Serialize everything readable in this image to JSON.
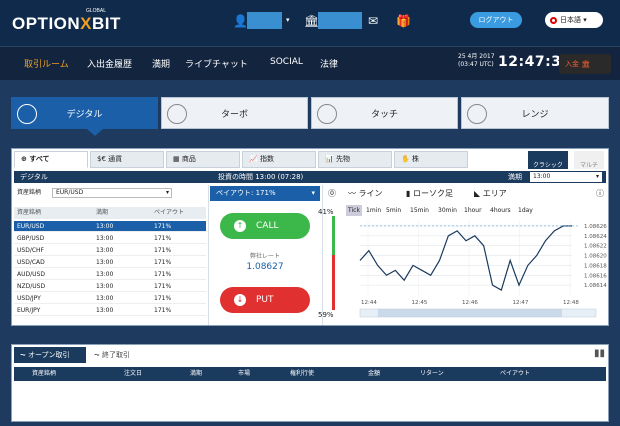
{
  "header": {
    "logo_main": "OPTION",
    "logo_x": "X",
    "logo_end": "BIT",
    "logo_sub": "GLOBAL",
    "logout_label": "ログアウト",
    "language": "日本語"
  },
  "nav": {
    "items": [
      "取引ルーム",
      "入出金履歴",
      "満期",
      "ライブチャット",
      "SOCIAL",
      "法律"
    ],
    "date": "25 4月 2017",
    "date_sub": "(03:47 UTC)",
    "clock": "12:47:32",
    "deposit_label": "入金"
  },
  "mode_tabs": [
    "デジタル",
    "ターボ",
    "タッチ",
    "レンジ"
  ],
  "category_tabs": [
    "すべて",
    "通貨",
    "商品",
    "指数",
    "先物",
    "株"
  ],
  "view_modes": [
    "クラシック",
    "マルチ"
  ],
  "bar": {
    "title": "デジタル",
    "invest_time_label": "投資の時間 13:00 (07:28)",
    "expiry_label": "満期",
    "expiry_value": "13:00"
  },
  "asset_filter": {
    "label": "資産銘柄",
    "value": "EUR/USD"
  },
  "table": {
    "headers": [
      "資産銘柄",
      "満期",
      "ペイアウト"
    ],
    "rows": [
      [
        "EUR/USD",
        "13:00",
        "171%"
      ],
      [
        "GBP/USD",
        "13:00",
        "171%"
      ],
      [
        "USD/CHF",
        "13:00",
        "171%"
      ],
      [
        "USD/CAD",
        "13:00",
        "171%"
      ],
      [
        "AUD/USD",
        "13:00",
        "171%"
      ],
      [
        "NZD/USD",
        "13:00",
        "171%"
      ],
      [
        "USD/JPY",
        "13:00",
        "171%"
      ],
      [
        "EUR/JPY",
        "13:00",
        "171%"
      ]
    ]
  },
  "trade": {
    "payout": "ペイアウト:  171%",
    "call_label": "CALL",
    "put_label": "PUT",
    "rate_label": "弊社レート",
    "rate_value": "1.08627"
  },
  "chart_tools": {
    "line": "ライン",
    "candle": "ローソク足",
    "area": "エリア",
    "timeframes": [
      "Tick",
      "1min",
      "5min",
      "15min",
      "30min",
      "1hour",
      "4hours",
      "1day"
    ]
  },
  "sentiment": {
    "call_pct": "41%",
    "put_pct": "59%",
    "call_fraction": 0.41
  },
  "chart_data": {
    "type": "line",
    "x": [
      "12:44",
      "12:44",
      "12:44",
      "12:44",
      "12:44",
      "12:44",
      "12:44",
      "12:45",
      "12:45",
      "12:45",
      "12:45",
      "12:45",
      "12:45",
      "12:46",
      "12:46",
      "12:46",
      "12:46",
      "12:46",
      "12:46",
      "12:47",
      "12:47",
      "12:47",
      "12:47",
      "12:47",
      "12:48"
    ],
    "y": [
      1.08619,
      1.08621,
      1.08618,
      1.08616,
      1.08617,
      1.08615,
      1.08618,
      1.08617,
      1.08616,
      1.08619,
      1.08624,
      1.08625,
      1.08623,
      1.08624,
      1.08622,
      1.08614,
      1.08613,
      1.08619,
      1.08614,
      1.08618,
      1.0862,
      1.08623,
      1.08625,
      1.08626,
      1.08626
    ],
    "yticks": [
      "1.08626",
      "1.08624",
      "1.08622",
      "1.08620",
      "1.08618",
      "1.08616",
      "1.08614"
    ],
    "xticks": [
      "12:44",
      "12:45",
      "12:46",
      "12:47",
      "12:48"
    ],
    "ylim": [
      1.08612,
      1.08627
    ],
    "title": "",
    "xlabel": "",
    "ylabel": ""
  },
  "open_trades": {
    "tabs": [
      "オープン取引",
      "終了取引"
    ],
    "headers": [
      "資産銘柄",
      "注文日",
      "満期",
      "市場",
      "権利行使",
      "金額",
      "リターン",
      "ペイアウト"
    ]
  }
}
